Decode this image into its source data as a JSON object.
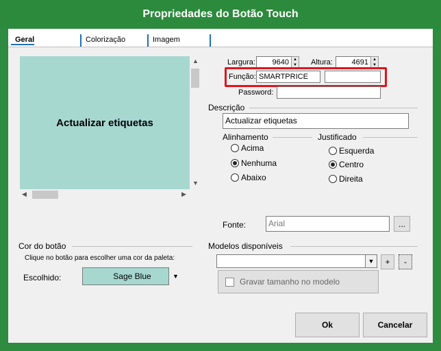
{
  "title": "Propriedades do Botão Touch",
  "tabs": [
    {
      "label": "Geral"
    },
    {
      "label": "Colorização"
    },
    {
      "label": "Imagem"
    }
  ],
  "preview": {
    "text": "Actualizar etiquetas",
    "color": "#a6d8d0"
  },
  "dimensions": {
    "width_label": "Largura:",
    "width_value": "9640",
    "height_label": "Altura:",
    "height_value": "4691"
  },
  "function": {
    "label": "Função:",
    "value": "SMARTPRICE",
    "extra_value": ""
  },
  "password": {
    "label": "Password:",
    "value": ""
  },
  "description": {
    "section": "Descrição",
    "value": "Actualizar etiquetas"
  },
  "alignment": {
    "section": "Alinhamento",
    "options": [
      "Acima",
      "Nenhuma",
      "Abaixo"
    ],
    "selected": "Nenhuma"
  },
  "justification": {
    "section": "Justificado",
    "options": [
      "Esquerda",
      "Centro",
      "Direita"
    ],
    "selected": "Centro"
  },
  "font": {
    "label": "Fonte:",
    "value": "Arial",
    "browse_label": "..."
  },
  "button_color": {
    "section": "Cor do botão",
    "hint": "Clique no botão para escolher uma cor da paleta:",
    "chosen_label": "Escolhido:",
    "chosen_value": "Sage Blue"
  },
  "models": {
    "section": "Modelos disponíveis",
    "selected": "",
    "add_label": "+",
    "remove_label": "-",
    "save_size_label": "Gravar tamanho no modelo"
  },
  "footer": {
    "ok_label": "Ok",
    "cancel_label": "Cancelar"
  },
  "colors": {
    "frame": "#2c8a3c",
    "highlight": "#e0141b",
    "swatch": "#a6d8d0"
  }
}
